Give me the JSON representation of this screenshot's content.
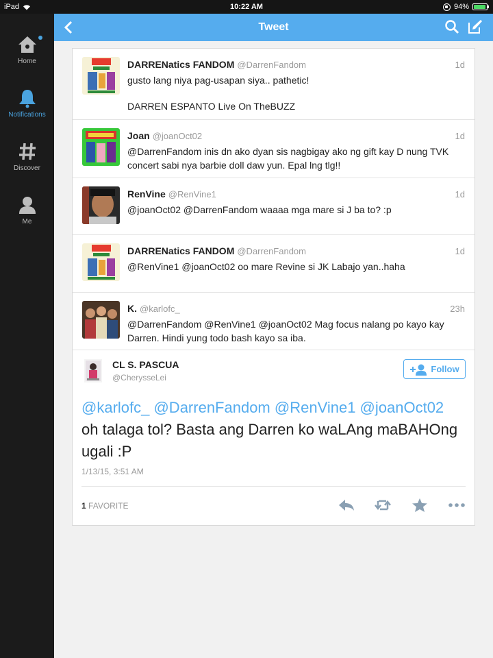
{
  "status_bar": {
    "device": "iPad",
    "time": "10:22 AM",
    "battery": "94%",
    "battery_level": 0.94
  },
  "sidebar": {
    "items": [
      {
        "label": "Home",
        "icon": "home-icon"
      },
      {
        "label": "Notifications",
        "icon": "bell-icon"
      },
      {
        "label": "Discover",
        "icon": "hashtag-icon"
      },
      {
        "label": "Me",
        "icon": "person-icon"
      }
    ],
    "active": "Notifications",
    "accent": "#4aa3df"
  },
  "navbar": {
    "title": "Tweet",
    "color": "#55acee"
  },
  "tweets": [
    {
      "name": "DARRENatics FANDOM",
      "handle": "@DarrenFandom",
      "time": "1d",
      "text": "gusto lang niya pag-usapan siya.. pathetic!",
      "text2": "DARREN ESPANTO Live On TheBUZZ"
    },
    {
      "name": "Joan",
      "handle": "@joanOct02",
      "time": "1d",
      "text": "@DarrenFandom inis dn ako dyan sis nagbigay ako ng gift kay D nung TVK concert sabi nya barbie doll daw yun. Epal lng tlg!!"
    },
    {
      "name": "RenVine",
      "handle": "@RenVine1",
      "time": "1d",
      "text": "@joanOct02 @DarrenFandom waaaa mga mare si J ba to? :p"
    },
    {
      "name": "DARRENatics FANDOM",
      "handle": "@DarrenFandom",
      "time": "1d",
      "text": "@RenVine1 @joanOct02 oo  mare Revine si JK Labajo yan..haha"
    },
    {
      "name": "K.",
      "handle": "@karlofc_",
      "time": "23h",
      "text": "@DarrenFandom @RenVine1 @joanOct02 Mag focus nalang po kayo kay Darren. Hindi yung todo bash kayo sa iba."
    }
  ],
  "detail": {
    "name": "CL S. PASCUA",
    "handle": "@CherysseLei",
    "follow_label": "Follow",
    "mentions": "@karlofc_ @DarrenFandom @RenVine1 @joanOct02",
    "text": "oh talaga tol? Basta ang Darren ko waLAng maBAHOng ugali  :P",
    "date": "1/13/15, 3:51 AM",
    "favorites_count": "1",
    "favorites_label": "FAVORITE",
    "actions": [
      "reply-icon",
      "retweet-icon",
      "star-icon",
      "more-icon"
    ]
  }
}
